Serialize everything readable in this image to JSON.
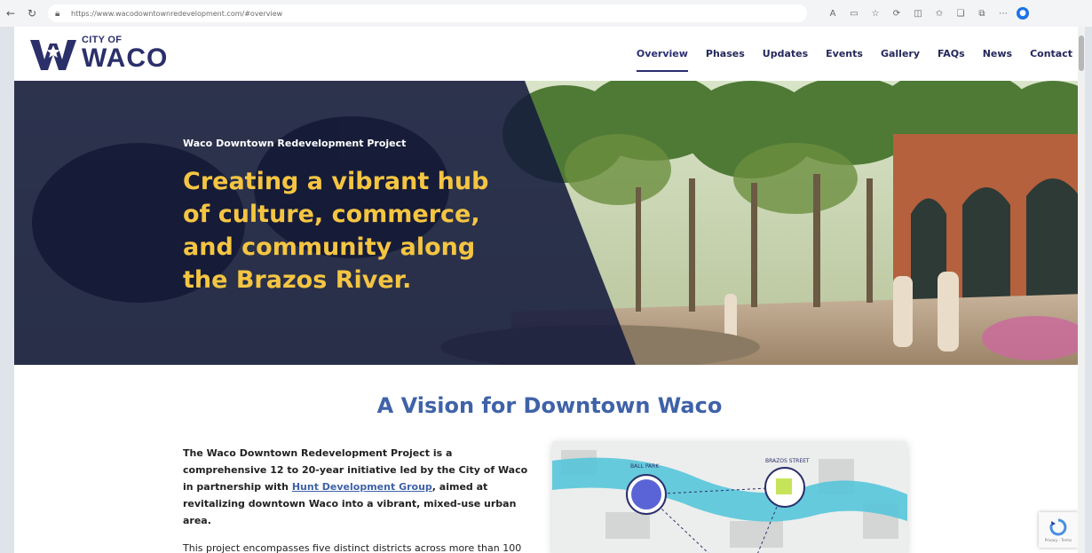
{
  "browser": {
    "url": "https://www.wacodowntownredevelopment.com/#overview",
    "icons": [
      "back-icon",
      "reload-icon",
      "lock-icon",
      "read-aloud-icon",
      "reader-view-icon",
      "favorite-icon",
      "refresh-icon",
      "split-screen-icon",
      "favorites-icon",
      "collections-icon",
      "extensions-icon",
      "more-icon",
      "edge-copilot-icon"
    ]
  },
  "site": {
    "logo": {
      "city": "CITY OF",
      "name": "WACO"
    },
    "nav": [
      {
        "label": "Overview",
        "active": true
      },
      {
        "label": "Phases"
      },
      {
        "label": "Updates"
      },
      {
        "label": "Events"
      },
      {
        "label": "Gallery"
      },
      {
        "label": "FAQs"
      },
      {
        "label": "News"
      },
      {
        "label": "Contact"
      }
    ]
  },
  "hero": {
    "kicker": "Waco Downtown Redevelopment Project",
    "headline": "Creating a vibrant hub of culture, commerce, and community along the Brazos River."
  },
  "vision": {
    "title": "A Vision for Downtown Waco",
    "para1_pre": "The Waco Downtown Redevelopment Project is a comprehensive 12 to 20-year initiative led by the City of Waco in partnership with ",
    "para1_link": "Hunt Development Group",
    "para1_post": ", aimed at revitalizing downtown Waco into a vibrant, mixed-use urban area.",
    "para2": "This project encompasses five distinct districts across more than 100",
    "map_labels": [
      "BALL PARK",
      "BRAZOS STREET"
    ]
  },
  "recaptcha": {
    "text": "Privacy - Terms"
  },
  "colors": {
    "navy": "#2b2f6a",
    "gold": "#f5c542",
    "blue": "#3f62a8"
  }
}
